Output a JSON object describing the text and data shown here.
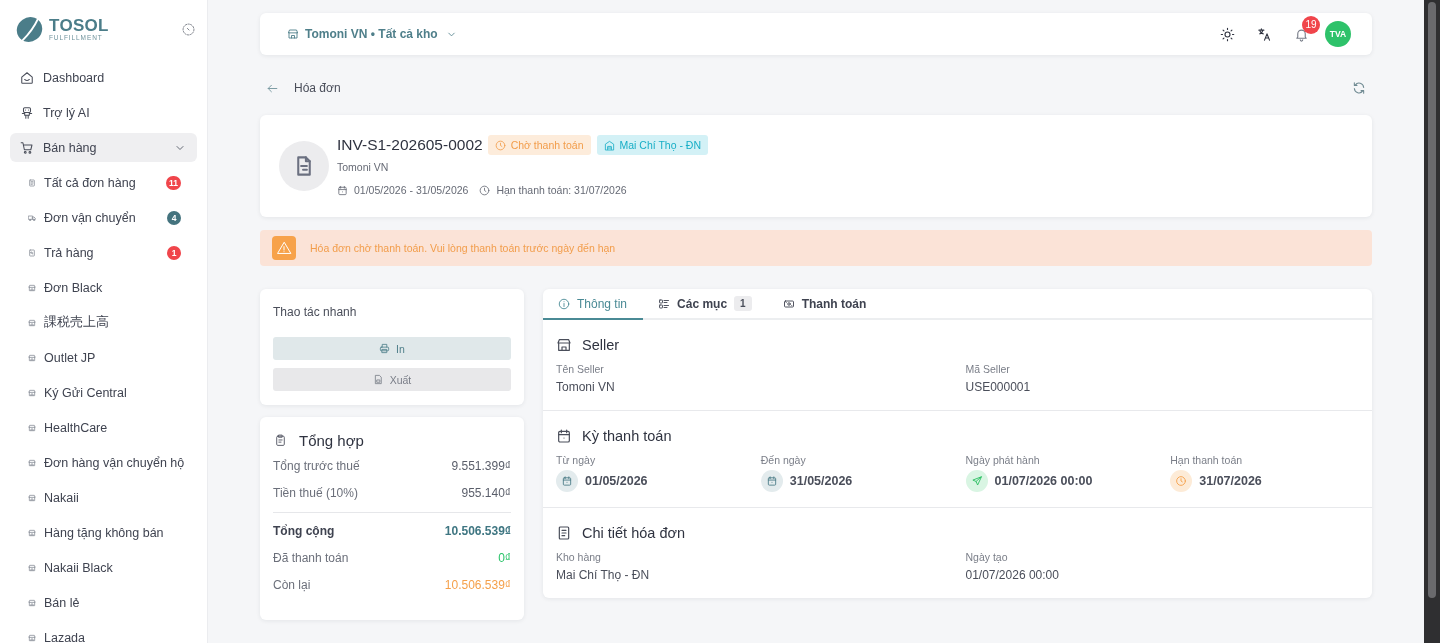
{
  "sidebar": {
    "brand": {
      "name": "TOSOL",
      "tagline": "FULFILLMENT"
    },
    "items": [
      {
        "label": "Dashboard",
        "selected": false
      },
      {
        "label": "Trợ lý AI",
        "selected": false
      },
      {
        "label": "Bán hàng",
        "selected": true,
        "expanded": true,
        "children": [
          {
            "label": "Tất cả đơn hàng",
            "selected": false,
            "badge": "11",
            "color": "#f0454b"
          },
          {
            "label": "Đơn vận chuyển",
            "selected": false,
            "badge": "4",
            "color": "#44737e"
          },
          {
            "label": "Trả hàng",
            "selected": false,
            "badge": "1",
            "color": "#f0454b"
          },
          {
            "label": "Đơn Black",
            "selected": false
          },
          {
            "label": "課税売上高",
            "selected": false
          },
          {
            "label": "Outlet JP",
            "selected": false
          },
          {
            "label": "Ký Gửi Central",
            "selected": false
          },
          {
            "label": "HealthCare",
            "selected": false
          },
          {
            "label": "Đơn hàng vận chuyển hộ",
            "selected": false
          },
          {
            "label": "Nakaii",
            "selected": false
          },
          {
            "label": "Hàng tặng không bán",
            "selected": false
          },
          {
            "label": "Nakaii Black",
            "selected": false
          },
          {
            "label": "Bán lẻ",
            "selected": false
          },
          {
            "label": "Lazada",
            "selected": false
          }
        ]
      }
    ]
  },
  "topbar": {
    "store_selector": "Tomoni VN • Tất cả kho",
    "notifications": "19",
    "avatar": "TVA"
  },
  "breadcrumb": {
    "title": "Hóa đơn"
  },
  "invoice": {
    "number": "INV-S1-202605-0002",
    "status": {
      "label": "Chờ thanh toán",
      "kind": "pending"
    },
    "warehouse": "Mai Chí Thọ - ĐN",
    "seller": "Tomoni VN",
    "period": "01/05/2026 - 31/05/2026",
    "due": "Hạn thanh toán: 31/07/2026"
  },
  "alert": {
    "kind": "warning",
    "message": "Hóa đơn chờ thanh toán. Vui lòng thanh toán trước ngày đến hạn"
  },
  "quick_actions": {
    "title": "Thao tác nhanh",
    "buttons": [
      {
        "label": "In",
        "kind": "primary"
      },
      {
        "label": "Xuất",
        "kind": "secondary"
      }
    ]
  },
  "summary": {
    "title": "Tổng hợp",
    "rows": [
      {
        "label": "Tổng trước thuế",
        "value": "9.551.399₫",
        "kind": "normal"
      },
      {
        "label": "Tiền thuế (10%)",
        "value": "955.140₫",
        "kind": "normal"
      },
      {
        "label": "Tổng cộng",
        "value": "10.506.539₫",
        "kind": "total"
      },
      {
        "label": "Đã thanh toán",
        "value": "0₫",
        "kind": "paid"
      },
      {
        "label": "Còn lại",
        "value": "10.506.539₫",
        "kind": "remaining"
      }
    ]
  },
  "tabs": [
    {
      "label": "Thông tin",
      "selected": true
    },
    {
      "label": "Các mục",
      "count": "1",
      "selected": false
    },
    {
      "label": "Thanh toán",
      "selected": false
    }
  ],
  "sections": [
    {
      "title": "Seller",
      "kind": "details",
      "fields": [
        {
          "label": "Tên Seller",
          "value": "Tomoni VN"
        },
        {
          "label": "Mã Seller",
          "value": "USE000001"
        }
      ]
    },
    {
      "title": "Kỳ thanh toán",
      "kind": "period",
      "fields": [
        {
          "label": "Từ ngày",
          "value": "01/05/2026",
          "kind": "start"
        },
        {
          "label": "Đến ngày",
          "value": "31/05/2026",
          "kind": "end"
        },
        {
          "label": "Ngày phát hành",
          "value": "01/07/2026 00:00",
          "kind": "issued"
        },
        {
          "label": "Hạn thanh toán",
          "value": "31/07/2026",
          "kind": "due"
        }
      ]
    },
    {
      "title": "Chi tiết hóa đơn",
      "kind": "details",
      "fields": [
        {
          "label": "Kho hàng",
          "value": "Mai Chí Thọ - ĐN"
        },
        {
          "label": "Ngày tạo",
          "value": "01/07/2026 00:00"
        }
      ]
    }
  ]
}
